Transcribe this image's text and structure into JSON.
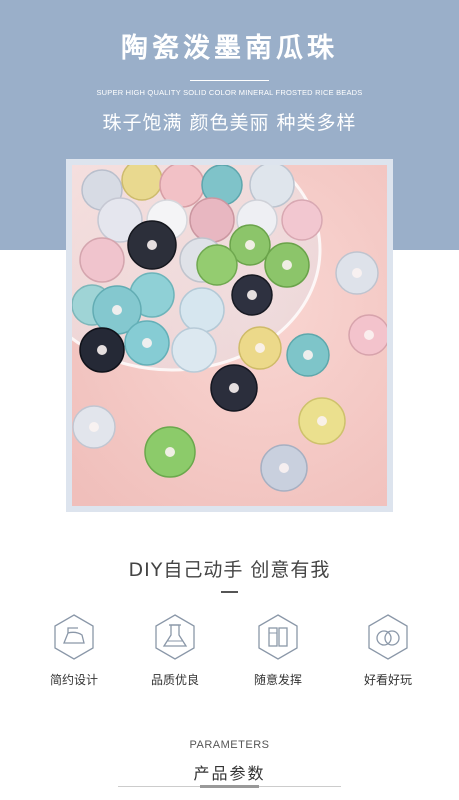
{
  "header": {
    "title": "陶瓷泼墨南瓜珠",
    "subtitle_en": "SUPER HIGH QUALITY SOLID COLOR MINERAL FROSTED RICE BEADS",
    "tagline": "珠子饱满 颜色美丽 种类多样",
    "background_color": "#9aafc9"
  },
  "photo": {
    "subject": "ceramic pumpkin beads on pink background in glass dish",
    "background_color": "#f5c9c6"
  },
  "diy": {
    "heading": "DIY自己动手 创意有我"
  },
  "features": [
    {
      "icon": "iron-icon",
      "label": "简约设计"
    },
    {
      "icon": "flask-icon",
      "label": "品质优良"
    },
    {
      "icon": "paint-icon",
      "label": "随意发挥"
    },
    {
      "icon": "rings-icon",
      "label": "好看好玩"
    }
  ],
  "parameters": {
    "label_en": "PARAMETERS",
    "label_cn": "产品参数"
  }
}
